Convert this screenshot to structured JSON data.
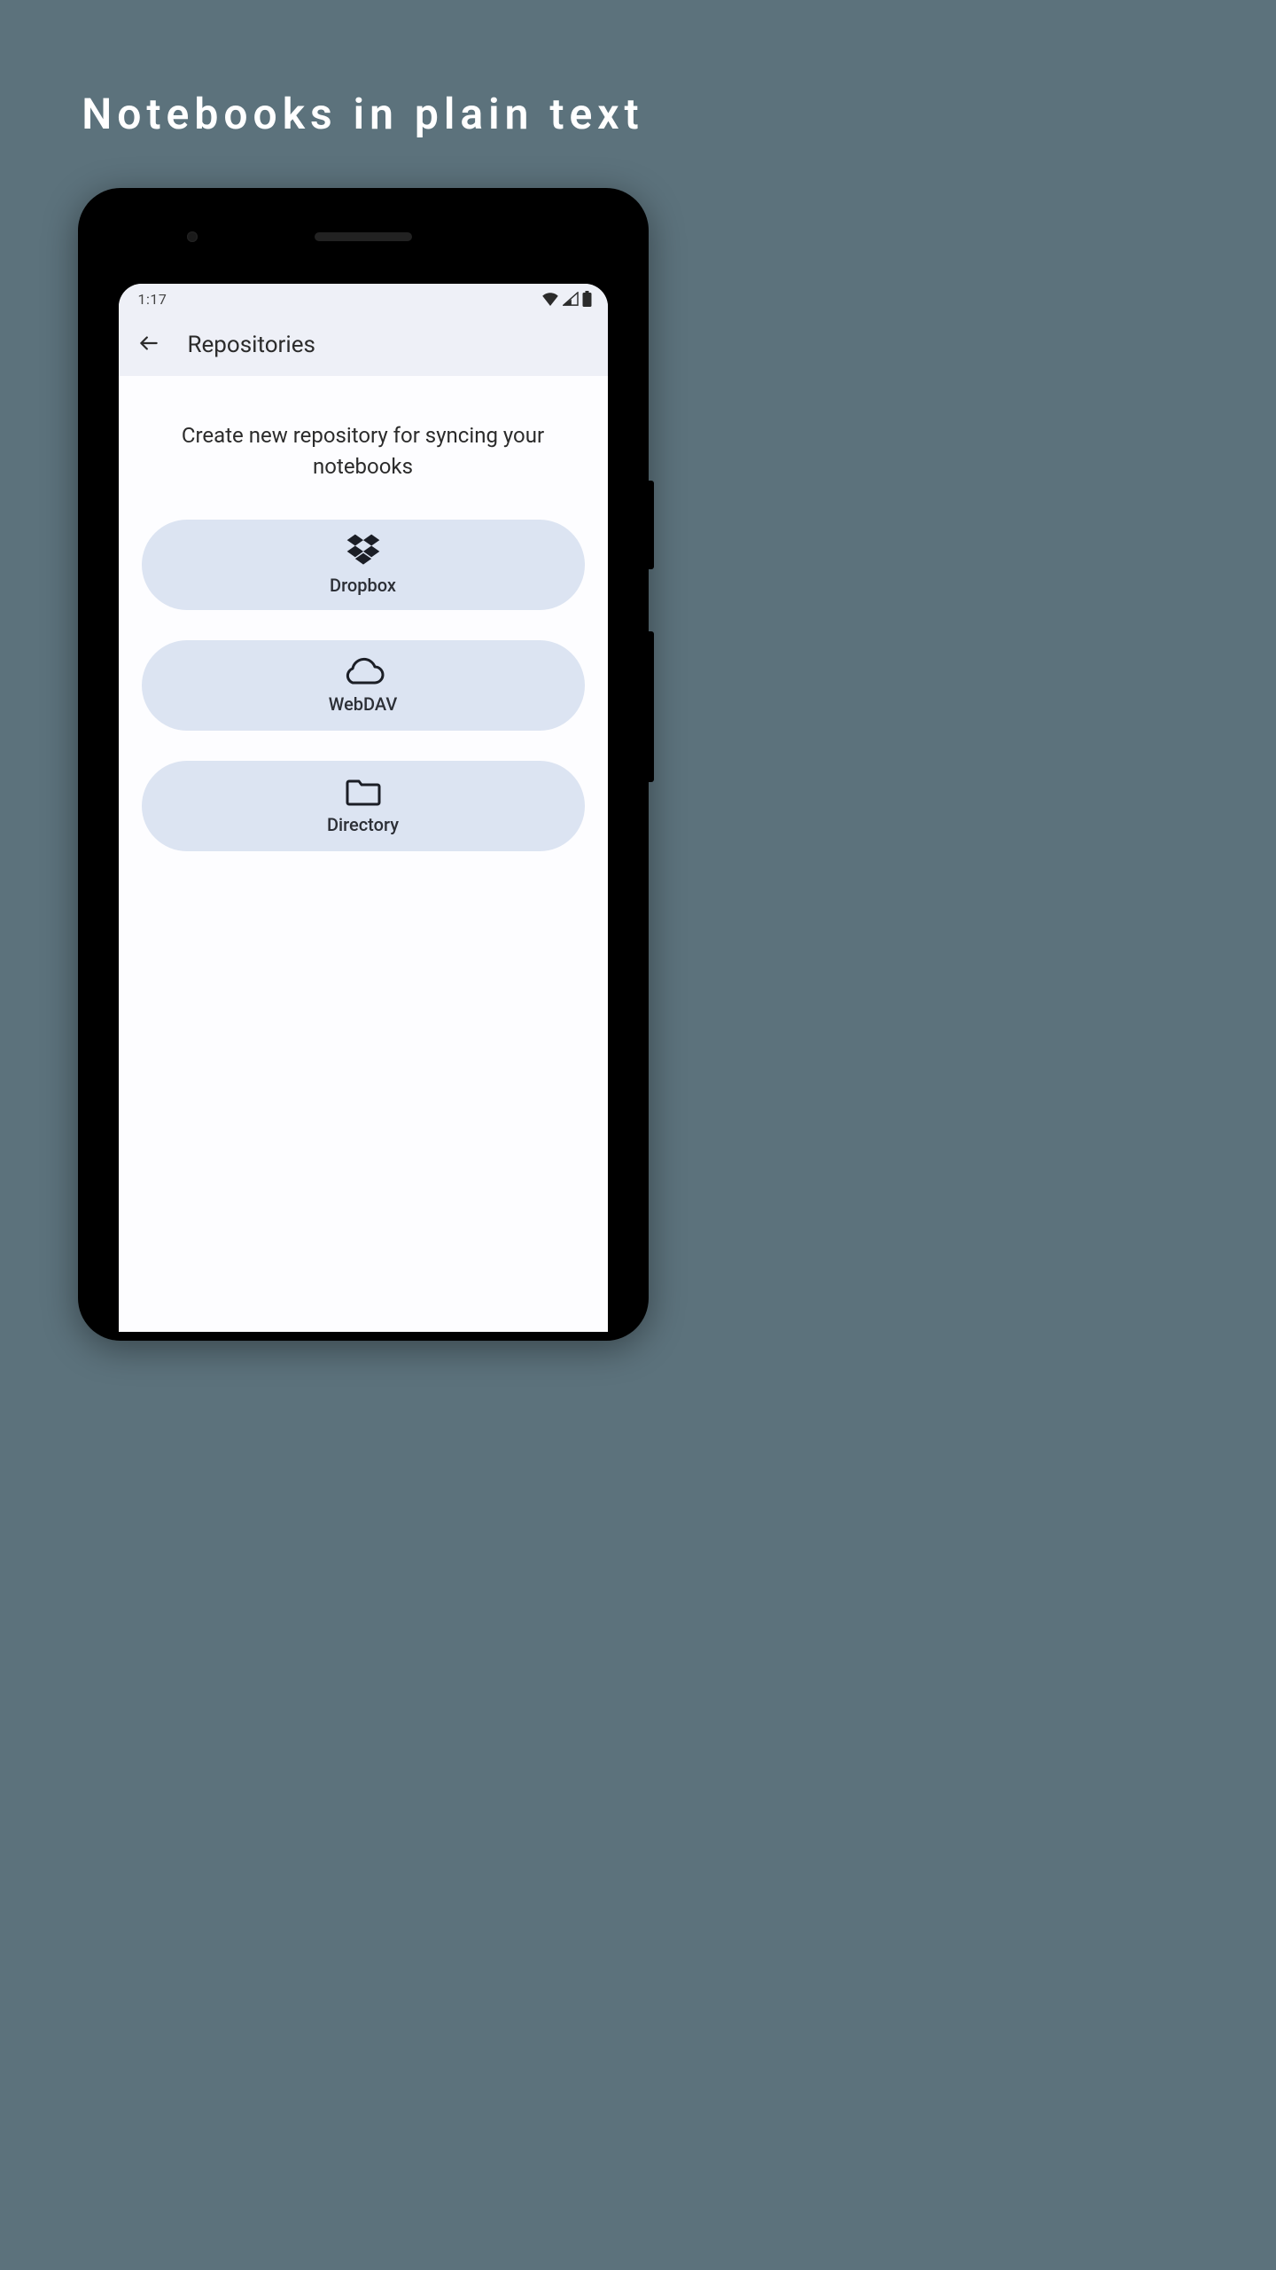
{
  "headline": "Notebooks in plain text",
  "statusbar": {
    "time": "1:17"
  },
  "appbar": {
    "title": "Repositories"
  },
  "content": {
    "subtitle": "Create new repository for syncing your notebooks",
    "options": [
      {
        "label": "Dropbox",
        "icon": "dropbox-icon"
      },
      {
        "label": "WebDAV",
        "icon": "cloud-icon"
      },
      {
        "label": "Directory",
        "icon": "folder-icon"
      }
    ]
  }
}
